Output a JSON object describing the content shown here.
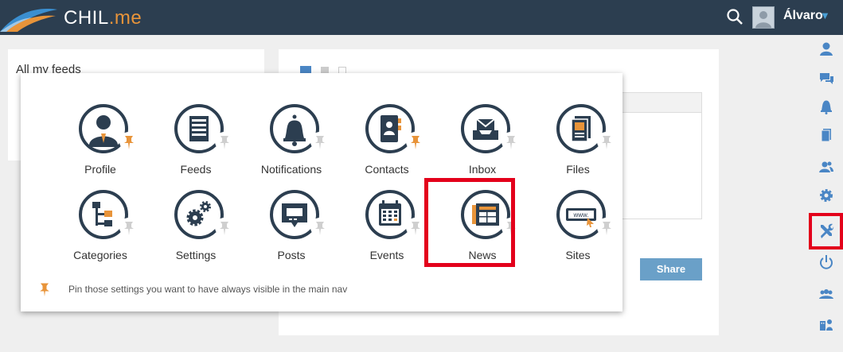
{
  "app": {
    "brand": "CHIL",
    "brand_suffix": ".me",
    "user_name": "Álvaro",
    "caret": "▼"
  },
  "colors": {
    "topbar": "#2c3e50",
    "icon_dark": "#2c3e50",
    "accent_orange": "#e8943a",
    "accent_blue": "#4a86c5",
    "highlight_red": "#e3001b"
  },
  "feeds": {
    "title": "All my feeds"
  },
  "post": {
    "share_label": "Share"
  },
  "menu": {
    "items": [
      {
        "label": "Profile",
        "icon": "profile-icon",
        "pinned": true
      },
      {
        "label": "Feeds",
        "icon": "feeds-icon",
        "pinned": false
      },
      {
        "label": "Notifications",
        "icon": "bell-icon",
        "pinned": false
      },
      {
        "label": "Contacts",
        "icon": "contacts-icon",
        "pinned": true
      },
      {
        "label": "Inbox",
        "icon": "inbox-icon",
        "pinned": false
      },
      {
        "label": "Files",
        "icon": "files-icon",
        "pinned": false
      },
      {
        "label": "Categories",
        "icon": "categories-icon",
        "pinned": false
      },
      {
        "label": "Settings",
        "icon": "settings-gears-icon",
        "pinned": false
      },
      {
        "label": "Posts",
        "icon": "posts-icon",
        "pinned": false
      },
      {
        "label": "Events",
        "icon": "calendar-icon",
        "pinned": false
      },
      {
        "label": "News",
        "icon": "news-icon",
        "pinned": false
      },
      {
        "label": "Sites",
        "icon": "website-icon",
        "pinned": false
      }
    ],
    "hint": "Pin those settings you want to have always visible in the main nav",
    "sites_url_text": "www."
  },
  "rail": {
    "icons": [
      "user-icon",
      "chat-icon",
      "bell-icon",
      "document-icon",
      "contacts-icon",
      "gear-icon",
      "tools-icon",
      "power-icon",
      "group-icon",
      "building-people-icon"
    ]
  }
}
